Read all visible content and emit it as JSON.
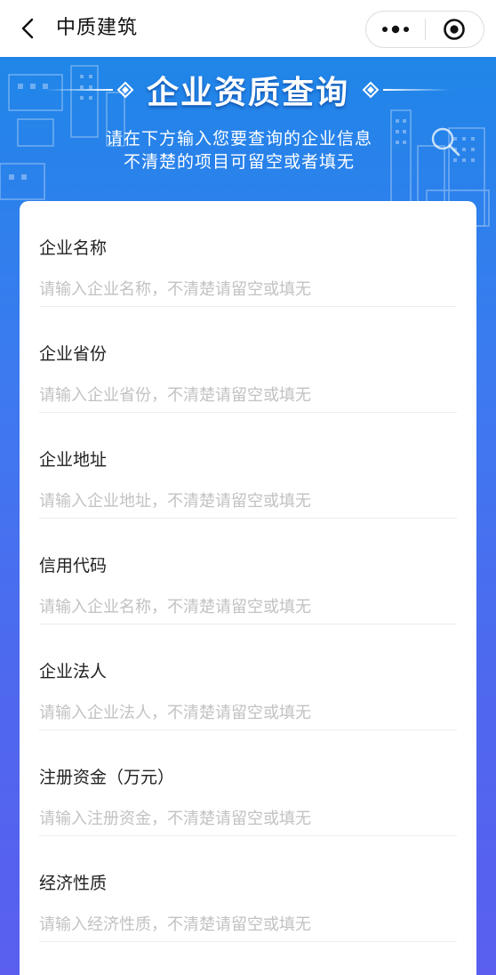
{
  "navbar": {
    "title": "中质建筑",
    "back_icon": "chevron-left-icon",
    "more_icon": "more-dots-icon",
    "close_icon": "target-circle-icon"
  },
  "banner": {
    "title": "企业资质查询",
    "subtitle_line1": "请在下方输入您要查询的企业信息",
    "subtitle_line2": "不清楚的项目可留空或者填无",
    "search_icon": "search-icon"
  },
  "colors": {
    "gradient_top": "#1f86e8",
    "gradient_bottom": "#5a5ff0",
    "placeholder": "#c2c2c2",
    "label": "#222222"
  },
  "form": {
    "fields": [
      {
        "label": "企业名称",
        "value": "",
        "placeholder": "请输入企业名称，不清楚请留空或填无"
      },
      {
        "label": "企业省份",
        "value": "",
        "placeholder": "请输入企业省份，不清楚请留空或填无"
      },
      {
        "label": "企业地址",
        "value": "",
        "placeholder": "请输入企业地址，不清楚请留空或填无"
      },
      {
        "label": "信用代码",
        "value": "",
        "placeholder": "请输入企业名称，不清楚请留空或填无"
      },
      {
        "label": "企业法人",
        "value": "",
        "placeholder": "请输入企业法人，不清楚请留空或填无"
      },
      {
        "label": "注册资金（万元）",
        "value": "",
        "placeholder": "请输入注册资金，不清楚请留空或填无"
      },
      {
        "label": "经济性质",
        "value": "",
        "placeholder": "请输入经济性质，不清楚请留空或填无"
      }
    ]
  }
}
